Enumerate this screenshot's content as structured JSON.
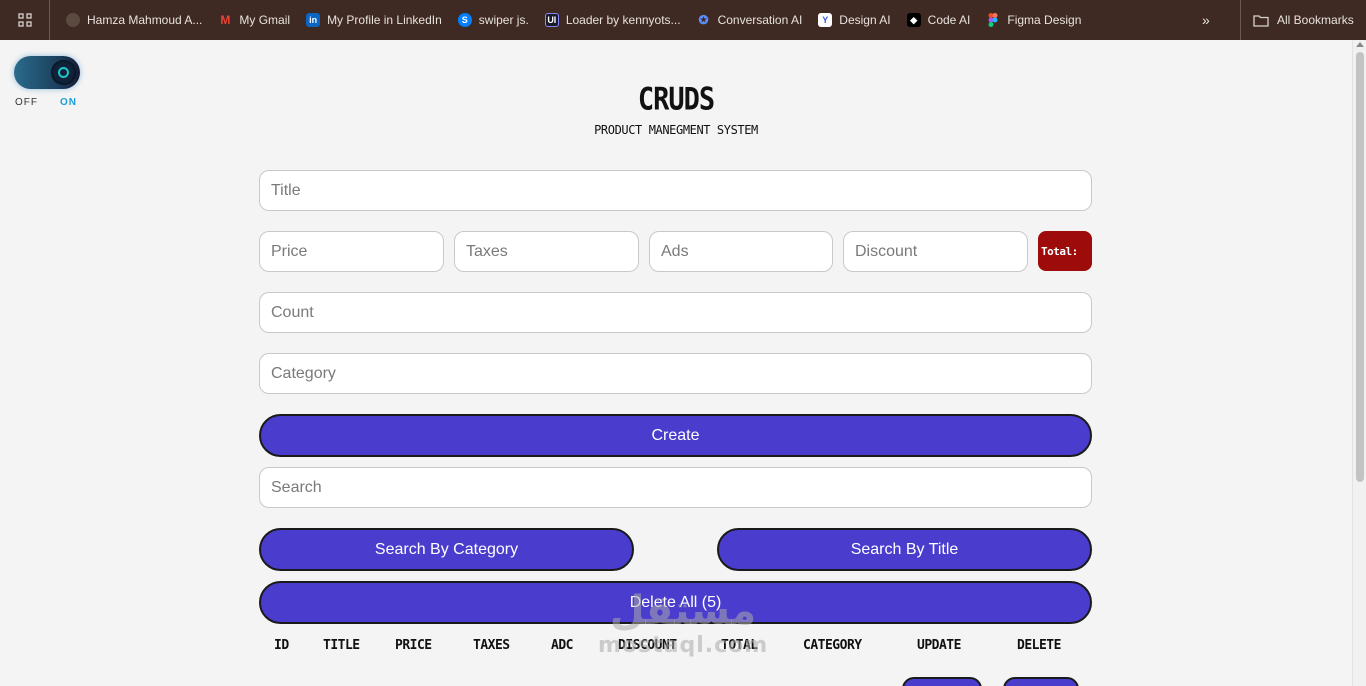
{
  "bookmarks_bar": {
    "items": [
      {
        "label": "Hamza Mahmoud A...",
        "icon": "profile-photo-icon"
      },
      {
        "label": "My Gmail",
        "icon": "gmail-icon"
      },
      {
        "label": "My Profile in LinkedIn",
        "icon": "linkedin-icon"
      },
      {
        "label": "swiper js.",
        "icon": "swiper-icon"
      },
      {
        "label": "Loader by kennyots...",
        "icon": "uiverse-icon"
      },
      {
        "label": "Conversation AI",
        "icon": "conversation-ai-icon"
      },
      {
        "label": "Design AI",
        "icon": "design-ai-icon"
      },
      {
        "label": "Code AI",
        "icon": "code-ai-icon"
      },
      {
        "label": "Figma Design",
        "icon": "figma-icon"
      }
    ],
    "more": "»",
    "all_bookmarks": "All Bookmarks"
  },
  "theme_toggle": {
    "off_label": "OFF",
    "on_label": "ON",
    "state": "on"
  },
  "header": {
    "title": "CRUDS",
    "subtitle": "PRODUCT MANEGMENT SYSTEM"
  },
  "form": {
    "title_placeholder": "Title",
    "price_placeholder": "Price",
    "taxes_placeholder": "Taxes",
    "ads_placeholder": "Ads",
    "discount_placeholder": "Discount",
    "total_label": "Total:",
    "count_placeholder": "Count",
    "category_placeholder": "Category",
    "create_label": "Create"
  },
  "search": {
    "placeholder": "Search",
    "by_category_label": "Search By Category",
    "by_title_label": "Search By Title"
  },
  "delete_all_label": "Delete All (5)",
  "table": {
    "headers": [
      "ID",
      "TITLE",
      "PRICE",
      "TAXES",
      "ADC",
      "DISCOUNT",
      "TOTAL",
      "CATEGORY",
      "UPDATE",
      "DELETE"
    ]
  },
  "watermark": {
    "arabic": "مستقل",
    "latin": "mostaql.com"
  },
  "colors": {
    "primary_button": "#4a3dce",
    "total_badge": "#9e0b0b",
    "bookmark_bar": "#3e2a22",
    "accent_on": "#1a9ed6"
  }
}
